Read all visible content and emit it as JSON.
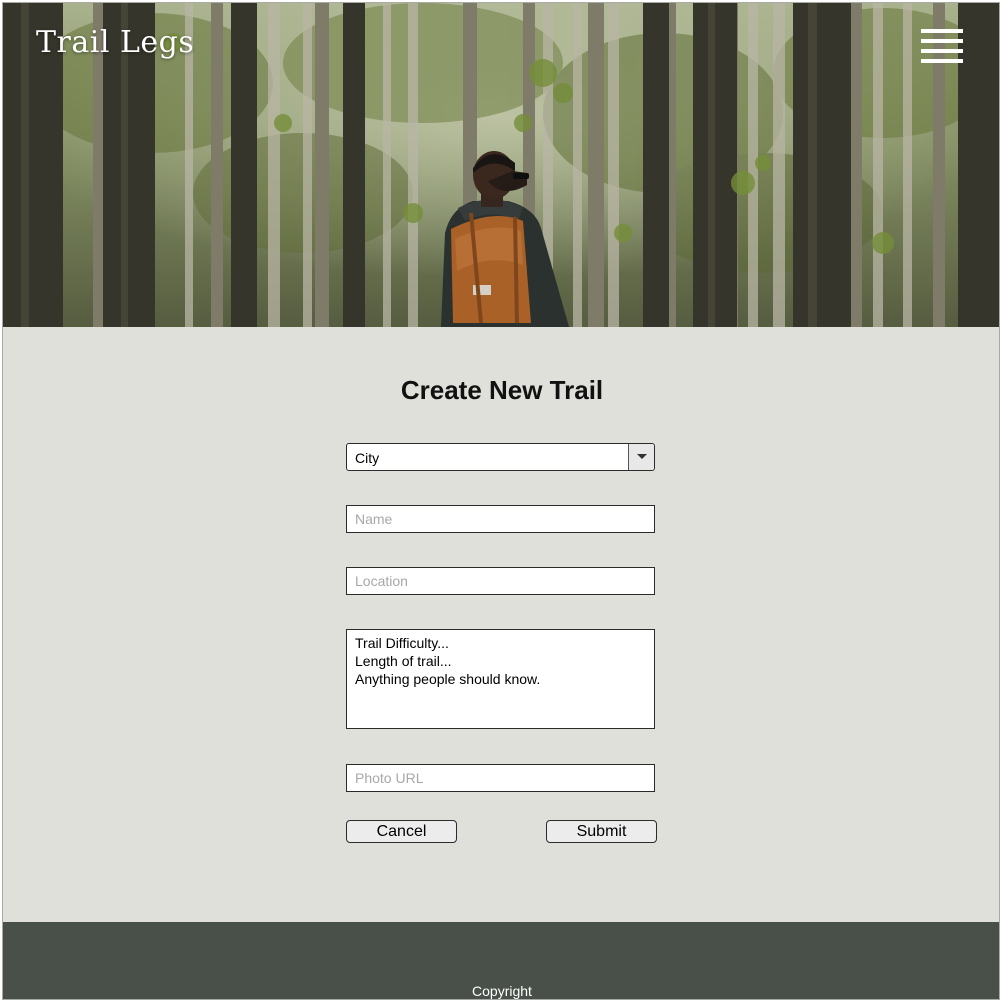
{
  "header": {
    "brand": "Trail Legs",
    "menu_icon": "hamburger-menu-icon",
    "hero_image": "person-with-backpack-in-forest"
  },
  "form": {
    "title": "Create New Trail",
    "city_select": {
      "selected": "City",
      "icon": "chevron-down-icon"
    },
    "name_placeholder": "Name",
    "location_placeholder": "Location",
    "description": "Trail Difficulty...\nLength of trail...\nAnything people should know.",
    "photo_url_placeholder": "Photo URL",
    "cancel_label": "Cancel",
    "submit_label": "Submit"
  },
  "footer": {
    "copyright": "Copyright"
  },
  "colors": {
    "page_background": "#dfe0da",
    "footer_background": "#485049",
    "pack_color": "#b86a2c"
  }
}
